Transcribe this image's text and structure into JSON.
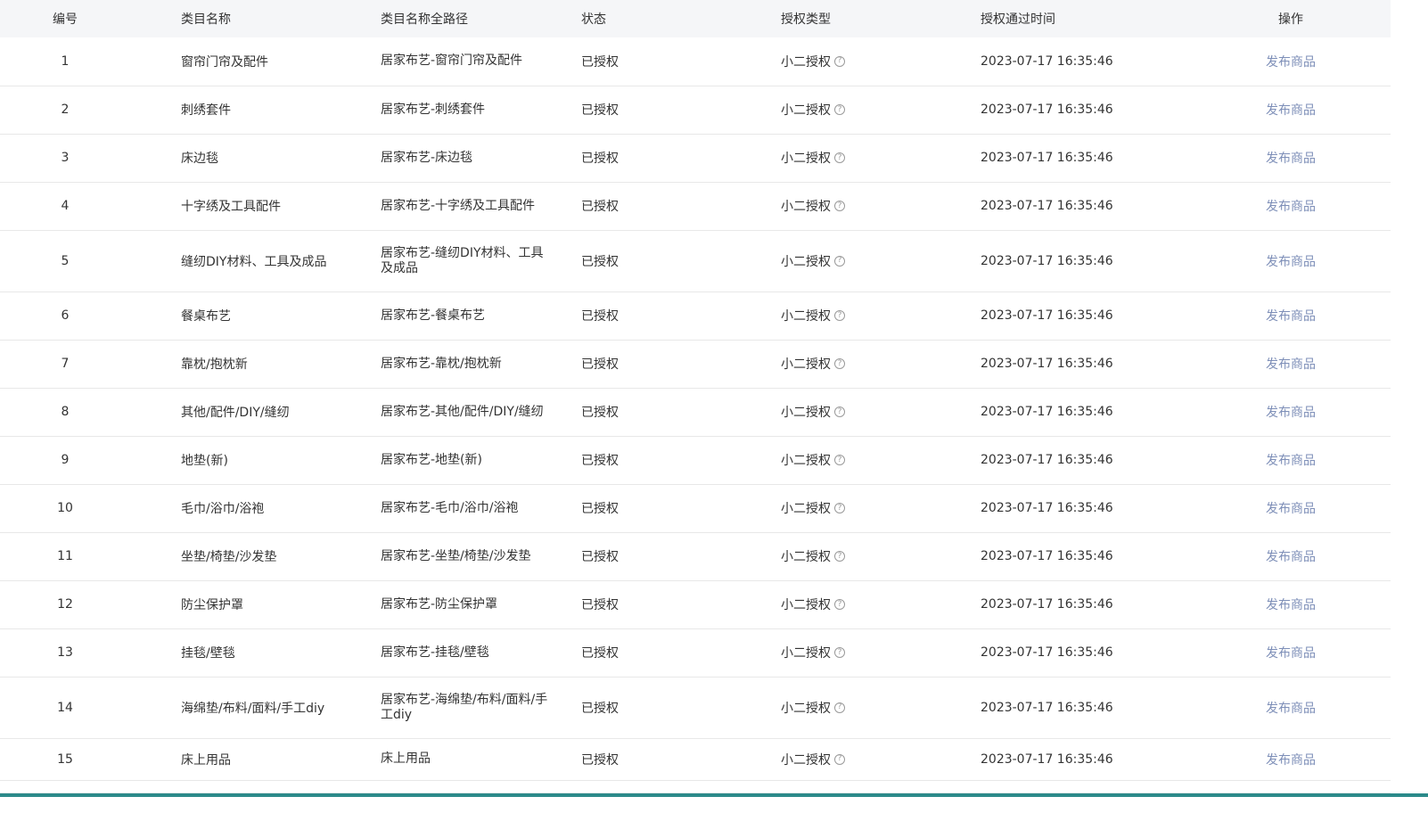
{
  "table": {
    "headers": {
      "index": "编号",
      "name": "类目名称",
      "path": "类目名称全路径",
      "status": "状态",
      "auth_type": "授权类型",
      "auth_time": "授权通过时间",
      "action": "操作"
    },
    "rows": [
      {
        "index": "1",
        "name": "窗帘门帘及配件",
        "path": "居家布艺-窗帘门帘及配件",
        "status": "已授权",
        "auth_type": "小二授权",
        "auth_time": "2023-07-17 16:35:46",
        "action": "发布商品"
      },
      {
        "index": "2",
        "name": "刺绣套件",
        "path": "居家布艺-刺绣套件",
        "status": "已授权",
        "auth_type": "小二授权",
        "auth_time": "2023-07-17 16:35:46",
        "action": "发布商品"
      },
      {
        "index": "3",
        "name": "床边毯",
        "path": "居家布艺-床边毯",
        "status": "已授权",
        "auth_type": "小二授权",
        "auth_time": "2023-07-17 16:35:46",
        "action": "发布商品"
      },
      {
        "index": "4",
        "name": "十字绣及工具配件",
        "path": "居家布艺-十字绣及工具配件",
        "status": "已授权",
        "auth_type": "小二授权",
        "auth_time": "2023-07-17 16:35:46",
        "action": "发布商品"
      },
      {
        "index": "5",
        "name": "缝纫DIY材料、工具及成品",
        "path": "居家布艺-缝纫DIY材料、工具及成品",
        "status": "已授权",
        "auth_type": "小二授权",
        "auth_time": "2023-07-17 16:35:46",
        "action": "发布商品"
      },
      {
        "index": "6",
        "name": "餐桌布艺",
        "path": "居家布艺-餐桌布艺",
        "status": "已授权",
        "auth_type": "小二授权",
        "auth_time": "2023-07-17 16:35:46",
        "action": "发布商品"
      },
      {
        "index": "7",
        "name": "靠枕/抱枕新",
        "path": "居家布艺-靠枕/抱枕新",
        "status": "已授权",
        "auth_type": "小二授权",
        "auth_time": "2023-07-17 16:35:46",
        "action": "发布商品"
      },
      {
        "index": "8",
        "name": "其他/配件/DIY/缝纫",
        "path": "居家布艺-其他/配件/DIY/缝纫",
        "status": "已授权",
        "auth_type": "小二授权",
        "auth_time": "2023-07-17 16:35:46",
        "action": "发布商品"
      },
      {
        "index": "9",
        "name": "地垫(新)",
        "path": "居家布艺-地垫(新)",
        "status": "已授权",
        "auth_type": "小二授权",
        "auth_time": "2023-07-17 16:35:46",
        "action": "发布商品"
      },
      {
        "index": "10",
        "name": "毛巾/浴巾/浴袍",
        "path": "居家布艺-毛巾/浴巾/浴袍",
        "status": "已授权",
        "auth_type": "小二授权",
        "auth_time": "2023-07-17 16:35:46",
        "action": "发布商品"
      },
      {
        "index": "11",
        "name": "坐垫/椅垫/沙发垫",
        "path": "居家布艺-坐垫/椅垫/沙发垫",
        "status": "已授权",
        "auth_type": "小二授权",
        "auth_time": "2023-07-17 16:35:46",
        "action": "发布商品"
      },
      {
        "index": "12",
        "name": "防尘保护罩",
        "path": "居家布艺-防尘保护罩",
        "status": "已授权",
        "auth_type": "小二授权",
        "auth_time": "2023-07-17 16:35:46",
        "action": "发布商品"
      },
      {
        "index": "13",
        "name": "挂毯/壁毯",
        "path": "居家布艺-挂毯/壁毯",
        "status": "已授权",
        "auth_type": "小二授权",
        "auth_time": "2023-07-17 16:35:46",
        "action": "发布商品"
      },
      {
        "index": "14",
        "name": "海绵垫/布料/面料/手工diy",
        "path": "居家布艺-海绵垫/布料/面料/手工diy",
        "status": "已授权",
        "auth_type": "小二授权",
        "auth_time": "2023-07-17 16:35:46",
        "action": "发布商品"
      },
      {
        "index": "15",
        "name": "床上用品",
        "path": "床上用品",
        "status": "已授权",
        "auth_type": "小二授权",
        "auth_time": "2023-07-17 16:35:46",
        "action": "发布商品"
      }
    ]
  },
  "icons": {
    "help": "question-circle-icon"
  },
  "colors": {
    "header_bg": "#f5f6f8",
    "row_border": "#e8e8e8",
    "link": "#7e8fb8",
    "text": "#333333",
    "bottom_bar": "#2b8a8a"
  }
}
